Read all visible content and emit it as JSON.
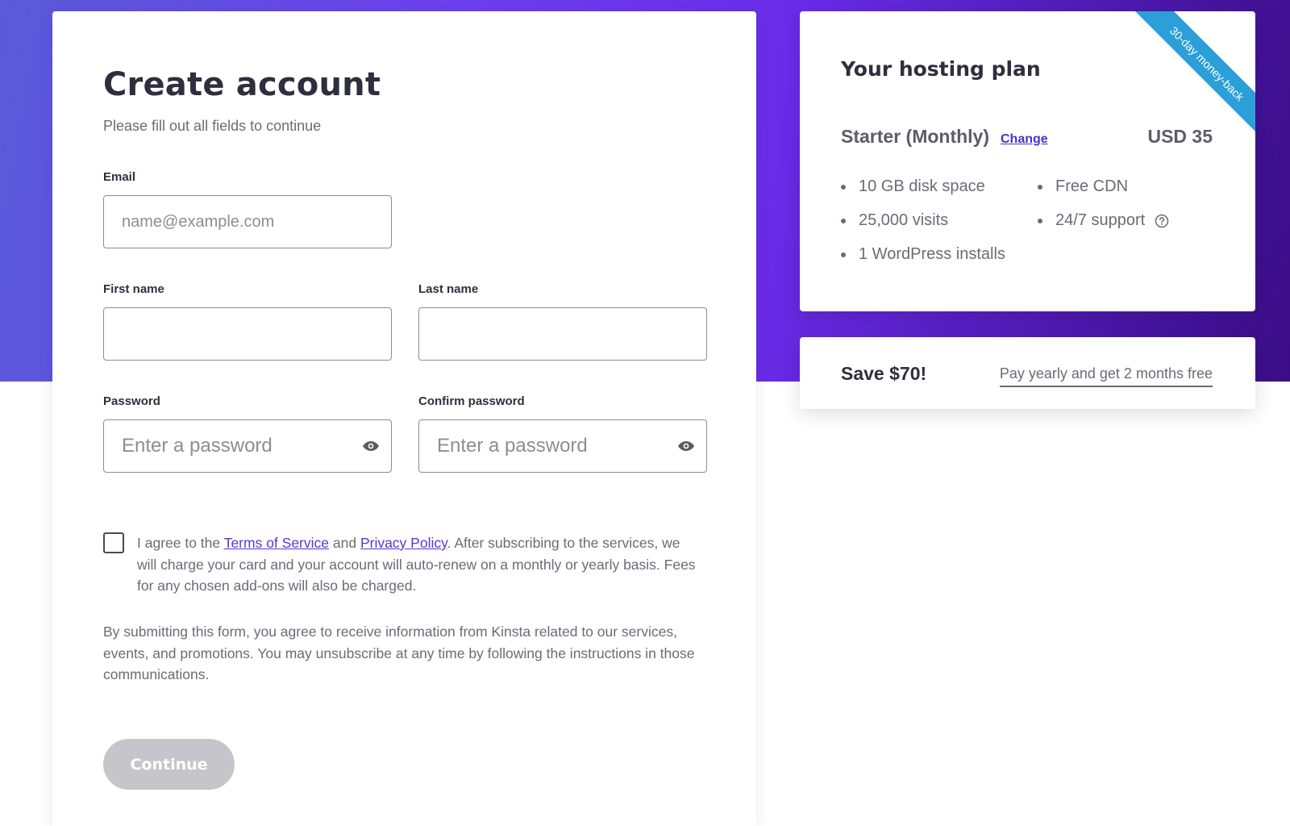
{
  "form": {
    "title": "Create account",
    "subtitle": "Please fill out all fields to continue",
    "email": {
      "label": "Email",
      "placeholder": "name@example.com",
      "value": ""
    },
    "first_name": {
      "label": "First name",
      "placeholder": "",
      "value": ""
    },
    "last_name": {
      "label": "Last name",
      "placeholder": "",
      "value": ""
    },
    "password": {
      "label": "Password",
      "placeholder": "Enter a password",
      "value": ""
    },
    "confirm_password": {
      "label": "Confirm password",
      "placeholder": "Enter a password",
      "value": ""
    },
    "agreement": {
      "checked": false,
      "prefix": "I agree to the ",
      "terms_link": "Terms of Service",
      "and": " and ",
      "privacy_link": "Privacy Policy",
      "suffix": ". After subscribing to the services, we will charge your card and your account will auto-renew on a monthly or yearly basis. Fees for any chosen add-ons will also be charged."
    },
    "marketing_notice": "By submitting this form, you agree to receive information from Kinsta related to our services, events, and promotions. You may unsubscribe at any time by following the instructions in those communications.",
    "continue_label": "Continue",
    "continue_enabled": false
  },
  "plan": {
    "title": "Your hosting plan",
    "ribbon": "30-day money-back",
    "name": "Starter (Monthly)",
    "change_label": "Change",
    "price": "USD 35",
    "features_left": [
      "10 GB disk space",
      "25,000 visits",
      "1 WordPress installs"
    ],
    "features_right": [
      "Free CDN",
      "24/7 support"
    ]
  },
  "save": {
    "title": "Save $70!",
    "link": "Pay yearly and get 2 months free"
  },
  "colors": {
    "gradient_start": "#5a5bd8",
    "gradient_mid": "#6a2be8",
    "gradient_end": "#3a0d86",
    "link": "#5b34d6",
    "ribbon": "#2c9fd9",
    "button_disabled": "#c6c6ca"
  },
  "icons": {
    "password_toggle": "eye-icon",
    "support_help": "question-circle-icon"
  }
}
